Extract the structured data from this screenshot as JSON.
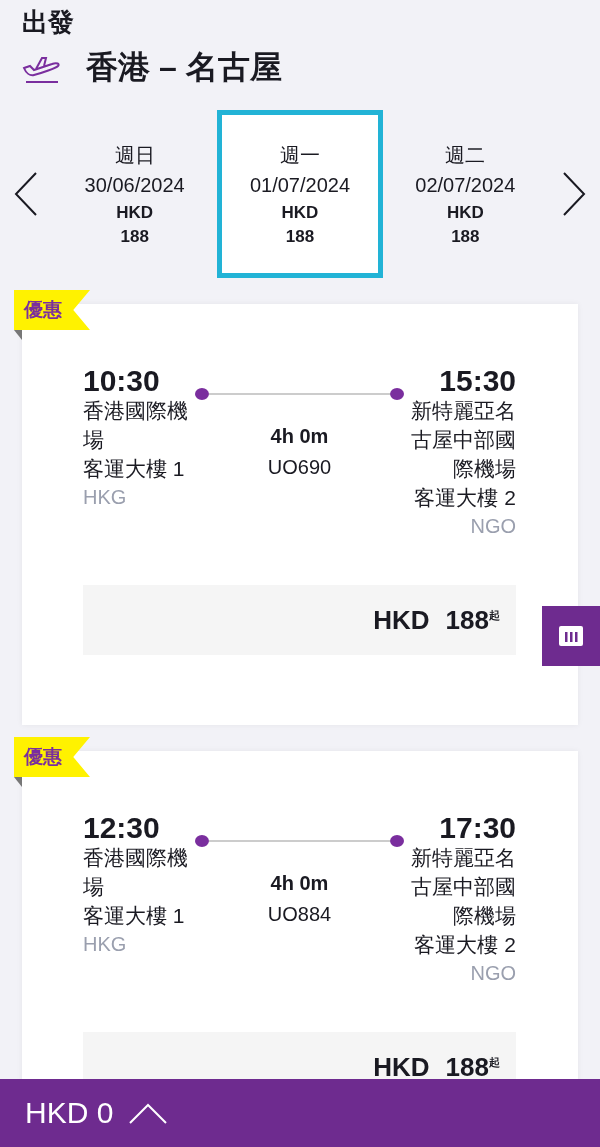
{
  "header": {
    "label": "出發",
    "route": "香港 – 名古屋"
  },
  "dates": [
    {
      "weekday": "週日",
      "date": "30/06/2024",
      "currency": "HKD",
      "price": "188",
      "selected": false
    },
    {
      "weekday": "週一",
      "date": "01/07/2024",
      "currency": "HKD",
      "price": "188",
      "selected": true
    },
    {
      "weekday": "週二",
      "date": "02/07/2024",
      "currency": "HKD",
      "price": "188",
      "selected": false
    }
  ],
  "flights": [
    {
      "tag": "優惠",
      "depart_time": "10:30",
      "depart_airport": "香港國際機場",
      "depart_terminal": "客運大樓 1",
      "depart_code": "HKG",
      "duration": "4h 0m",
      "flight_no": "UO690",
      "arrive_time": "15:30",
      "arrive_airport": "新特麗亞名古屋中部國際機場",
      "arrive_terminal": "客運大樓 2",
      "arrive_code": "NGO",
      "currency": "HKD",
      "price": "188$^{起}$"
    },
    {
      "tag": "優惠",
      "depart_time": "12:30",
      "depart_airport": "香港國際機場",
      "depart_terminal": "客運大樓 1",
      "depart_code": "HKG",
      "duration": "4h 0m",
      "flight_no": "UO884",
      "arrive_time": "17:30",
      "arrive_airport": "新特麗亞名古屋中部國際機場",
      "arrive_terminal": "客運大樓 2",
      "arrive_code": "NGO",
      "currency": "HKD",
      "price": "188$^{起}$"
    }
  ],
  "bottom_bar": {
    "total": "HKD 0"
  }
}
